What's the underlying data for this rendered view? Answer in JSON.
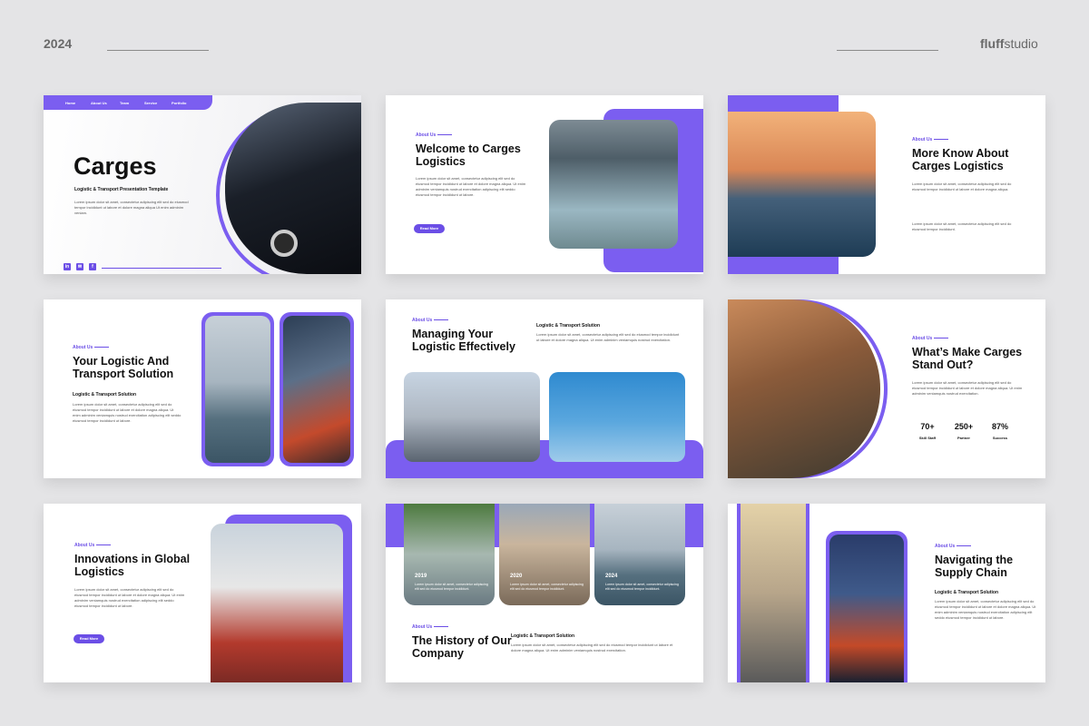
{
  "header": {
    "year": "2024",
    "brand_bold": "fluff",
    "brand_light": "studio"
  },
  "colors": {
    "accent": "#6b4ee6",
    "background": "#e4e4e6"
  },
  "common": {
    "about_us": "About Us",
    "read_more": "Read More",
    "subtitle": "Logistic & Transport Solution",
    "lorem_long": "Lorem ipsum dolor sit amet, consectetur adipiscing elit sed do eiusmod tempor incididunt ut labore et dolore magna aliqua. Ut enim adminim veniamquis nostrud exercitation adipiscing elit seddo eiusmod tempor incididunt ut labore.",
    "lorem_mid": "Lorem ipsum dolor sit amet, consectetur adipiscing elit sed do eiusmod tempor incididunt ut labore et dolore magna aliqua. Ut enim adminim veniamquis nostrud exercitation.",
    "lorem_short": "Lorem ipsum dolor sit amet, consectetur adipiscing elit sed do eiusmod tempor incididunt ut labore et dolore magna aliqua.",
    "lorem_tiny": "Lorem ipsum dolor sit amet, consectetur adipiscing elit sed do eiusmod tempor incididunt."
  },
  "slide1": {
    "nav": [
      "Home",
      "About Us",
      "Team",
      "Service",
      "Portfolio"
    ],
    "title": "Carges",
    "subtitle": "Logistic & Transport Presentation Template",
    "body": "Lorem ipsum dolor sit amet, consectetur adipiscing elit sed do eiusmod tempor incididunt ut labore et dolore magna aliqua Ut enim adminim veniam.",
    "social": [
      "in",
      "✉",
      "f"
    ]
  },
  "slide2": {
    "title": "Welcome to Carges Logistics"
  },
  "slide3": {
    "title": "More Know About Carges Logistics"
  },
  "slide4": {
    "title": "Your Logistic And Transport Solution"
  },
  "slide5": {
    "title": "Managing Your Logistic Effectively"
  },
  "slide6": {
    "title": "What’s Make Carges Stand Out?",
    "stats": [
      {
        "value": "70+",
        "label": "Skill Staff"
      },
      {
        "value": "250+",
        "label": "Partner"
      },
      {
        "value": "87%",
        "label": "Success"
      }
    ]
  },
  "slide7": {
    "title": "Innovations in Global Logistics"
  },
  "slide8": {
    "title": "The History of Our Company",
    "years": [
      "2019",
      "2020",
      "2024"
    ]
  },
  "slide9": {
    "title": "Navigating the Supply Chain"
  }
}
